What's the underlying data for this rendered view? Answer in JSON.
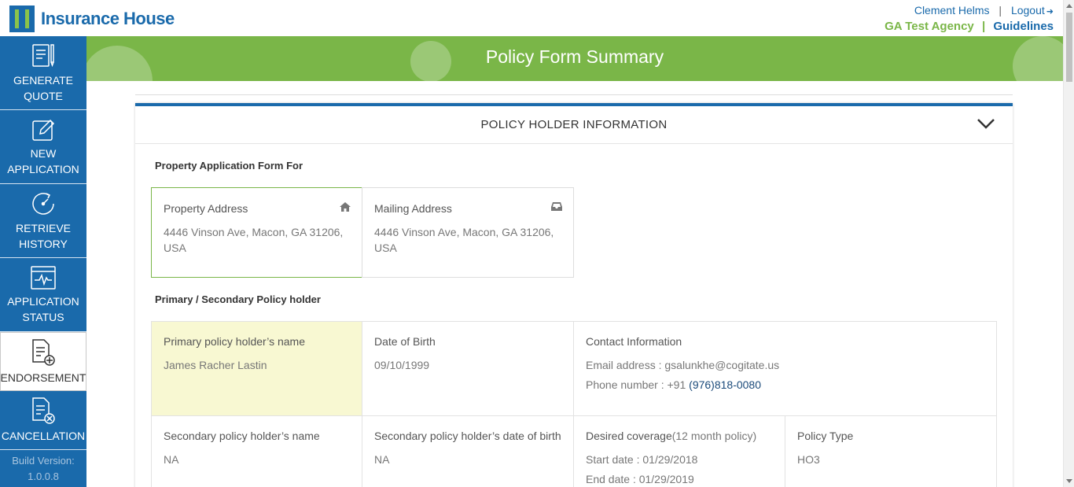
{
  "header": {
    "logo_text": "Insurance House",
    "user_name": "Clement Helms",
    "separator": "|",
    "logout_label": "Logout",
    "agency": "GA Test Agency",
    "guidelines_label": "Guidelines"
  },
  "sidebar": {
    "items": [
      {
        "line1": "GENERATE",
        "line2": "QUOTE",
        "icon": "document-pen-icon"
      },
      {
        "line1": "NEW",
        "line2": "APPLICATION",
        "icon": "pencil-square-icon"
      },
      {
        "line1": "RETRIEVE",
        "line2": "HISTORY",
        "icon": "history-clock-icon"
      },
      {
        "line1": "APPLICATION",
        "line2": "STATUS",
        "icon": "monitor-pulse-icon"
      },
      {
        "line1": "ENDORSEMENT",
        "line2": "",
        "icon": "document-plus-icon"
      },
      {
        "line1": "CANCELLATION",
        "line2": "",
        "icon": "document-cancel-icon"
      }
    ],
    "build_label": "Build Version:",
    "build_version": "1.0.0.8"
  },
  "banner": {
    "title": "Policy Form Summary"
  },
  "card": {
    "title": "POLICY HOLDER INFORMATION",
    "property_section": "Property Application Form For",
    "property_address_label": "Property Address",
    "property_address_line1": "4446 Vinson Ave, Macon, GA 31206,",
    "property_address_line2": "USA",
    "mailing_address_label": "Mailing Address",
    "mailing_address_line1": "4446 Vinson Ave, Macon, GA 31206,",
    "mailing_address_line2": "USA",
    "holder_section": "Primary / Secondary Policy holder",
    "primary_name_label": "Primary policy holder’s name",
    "primary_name": "James Racher Lastin",
    "dob_label": "Date of Birth",
    "dob": "09/10/1999",
    "contact_label": "Contact Information",
    "email_text": "Email address : gsalunkhe@cogitate.us",
    "phone_prefix": "Phone number : +91 ",
    "phone_number": "(976)818-0080",
    "secondary_name_label": "Secondary policy holder’s name",
    "secondary_name": "NA",
    "secondary_dob_label": "Secondary policy holder’s date of birth",
    "secondary_dob": "NA",
    "coverage_label": "Desired coverage",
    "coverage_suffix": "(12 month policy)",
    "start_date": "Start date : 01/29/2018",
    "end_date": "End date : 01/29/2019",
    "policy_type_label": "Policy Type",
    "policy_type": "HO3"
  },
  "colors": {
    "brand_blue": "#1a6aab",
    "brand_green": "#7ab648",
    "highlight": "#f8f8d2"
  }
}
